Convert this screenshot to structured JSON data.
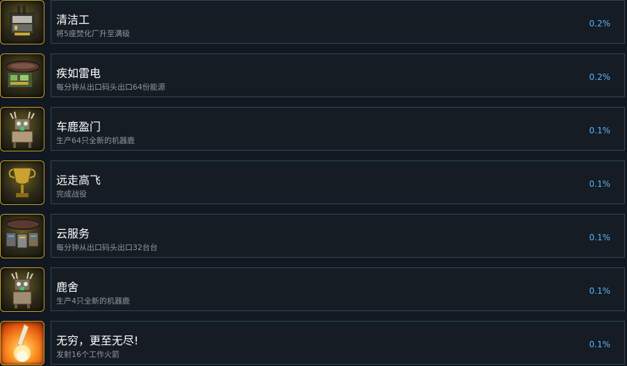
{
  "achievements": [
    {
      "title": "清洁工",
      "desc": "将5座焚化厂升至满级",
      "percent": "0.2%",
      "icon": "incinerator-icon"
    },
    {
      "title": "疾如雷电",
      "desc": "每分钟从出口码头出口64份能源",
      "percent": "0.2%",
      "icon": "dock-energy-icon"
    },
    {
      "title": "车鹿盈门",
      "desc": "生产64只全新的机器鹿",
      "percent": "0.1%",
      "icon": "robot-deer-icon"
    },
    {
      "title": "远走高飞",
      "desc": "完成战役",
      "percent": "0.1%",
      "icon": "trophy-icon"
    },
    {
      "title": "云服务",
      "desc": "每分钟从出口码头出口32台台",
      "percent": "0.1%",
      "icon": "dock-servers-icon"
    },
    {
      "title": "鹿舍",
      "desc": "生产4只全新的机器鹿",
      "percent": "0.1%",
      "icon": "robot-deer-icon"
    },
    {
      "title": "无穷，更至无尽!",
      "desc": "发射16个工作火箭",
      "percent": "0.1%",
      "icon": "rocket-launch-icon"
    }
  ]
}
